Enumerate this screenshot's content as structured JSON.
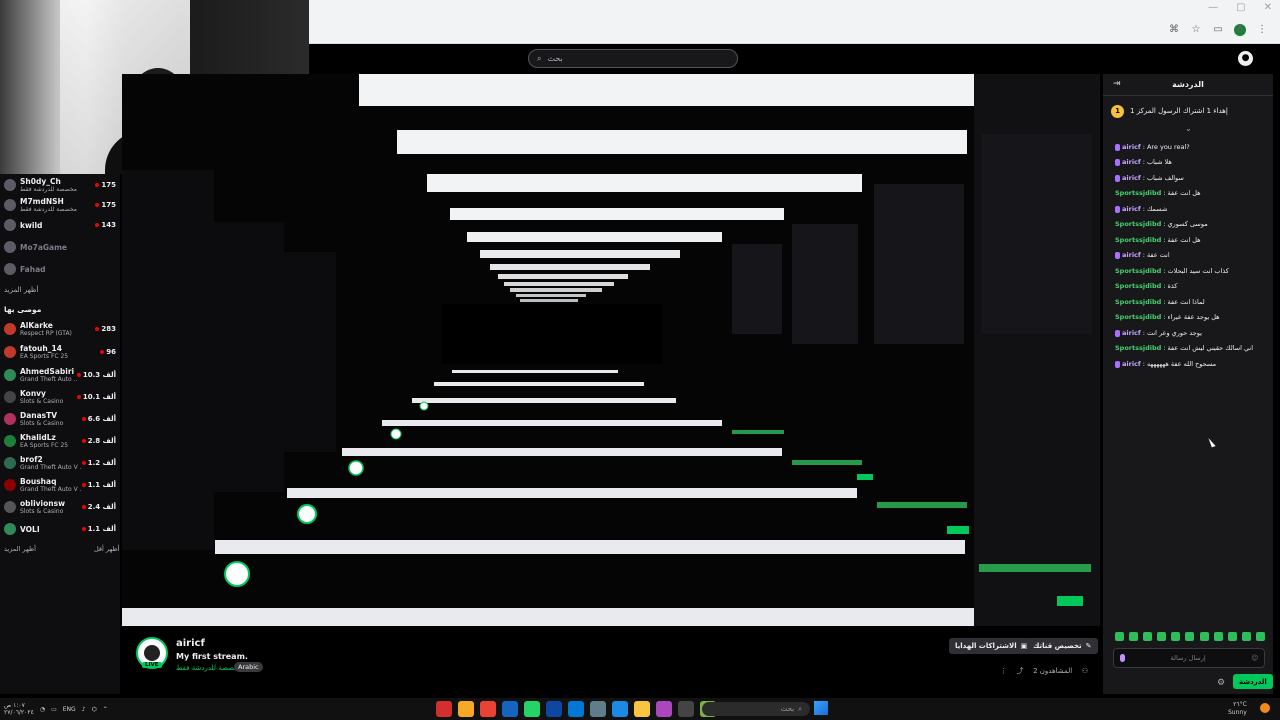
{
  "header": {
    "search_placeholder": "بحث"
  },
  "sidebar": {
    "top_channels": [
      {
        "name": "Sh0dy_Ch",
        "category": "مخصصة للدردشة فقط",
        "viewers": "175",
        "online": true
      },
      {
        "name": "M7mdNSH",
        "category": "مخصصة للدردشة فقط",
        "viewers": "175",
        "online": true
      },
      {
        "name": "kwild",
        "category": "",
        "viewers": "143",
        "online": true
      },
      {
        "name": "Mo7aGame",
        "category": "",
        "viewers": "",
        "online": false
      },
      {
        "name": "Fahad",
        "category": "",
        "viewers": "",
        "online": false
      }
    ],
    "show_more_1": "أظهر المزيد",
    "recommended_heading": "موصى بها",
    "recommended": [
      {
        "name": "AlKarke",
        "category": "Respect RP (GTA)",
        "viewers": "283"
      },
      {
        "name": "fatouh_14",
        "category": "EA Sports FC 25",
        "viewers": "96"
      },
      {
        "name": "AhmedSabiri",
        "category": "Grand Theft Auto ...",
        "viewers": "10.3 ألف"
      },
      {
        "name": "Konvy",
        "category": "Slots & Casino",
        "viewers": "10.1 ألف"
      },
      {
        "name": "DanasTV",
        "category": "Slots & Casino",
        "viewers": "6.6 ألف"
      },
      {
        "name": "KhalidLz",
        "category": "EA Sports FC 25",
        "viewers": "2.8 ألف"
      },
      {
        "name": "brof2",
        "category": "Grand Theft Auto V ...",
        "viewers": "1.2 ألف"
      },
      {
        "name": "Boushaq",
        "category": "Grand Theft Auto V ...",
        "viewers": "1.1 ألف"
      },
      {
        "name": "oblivionsw",
        "category": "Slots & Casino",
        "viewers": "2.4 ألف"
      },
      {
        "name": "VOLI",
        "category": "",
        "viewers": "1.1 ألف"
      }
    ],
    "show_more_2": "أظهر المزيد",
    "show_less": "أظهر أقل"
  },
  "stream": {
    "channel": "airicf",
    "title": "My first stream.",
    "category": "مخصصة للدردشة فقط",
    "language": "Arabic",
    "live": "LIVE",
    "subscriptions_button": "الاشتراكات الهدايا",
    "customize_button": "تخصيص قناتك",
    "viewers_label": "2 المشاهدون"
  },
  "chat": {
    "header": "الدردشة",
    "pinned": "إهداء 1 اشتراك الرسول المركز 1",
    "messages": [
      {
        "user": "airicf",
        "text": "Are you real?",
        "type": "a"
      },
      {
        "user": "airicf",
        "text": "هلا شباب",
        "type": "a"
      },
      {
        "user": "airicf",
        "text": "سوالف شباب",
        "type": "a"
      },
      {
        "user": "Sportssjdibd",
        "text": "هل انت عفة",
        "type": "s"
      },
      {
        "user": "airicf",
        "text": "شسمك",
        "type": "a"
      },
      {
        "user": "Sportssjdibd",
        "text": "موسى كسوري",
        "type": "s"
      },
      {
        "user": "Sportssjdibd",
        "text": "هل انت عفة",
        "type": "s"
      },
      {
        "user": "airicf",
        "text": "انت عفة",
        "type": "a"
      },
      {
        "user": "Sportssjdibd",
        "text": "كذاب انت سيد البحلات",
        "type": "s"
      },
      {
        "user": "Sportssjdibd",
        "text": "كذة",
        "type": "s"
      },
      {
        "user": "Sportssjdibd",
        "text": "لماذا انت عفة",
        "type": "s"
      },
      {
        "user": "Sportssjdibd",
        "text": "هل يوجد عفة عيراء",
        "type": "s"
      },
      {
        "user": "airicf",
        "text": "يوجد حوري وعر انت",
        "type": "a"
      },
      {
        "user": "Sportssjdibd",
        "text": "اني اسالك حقيني ليش انت عفة",
        "type": "s"
      },
      {
        "user": "airicf",
        "text": "مسحوح الله عفة ههههههه",
        "type": "a"
      }
    ],
    "input_placeholder": "إرسال رسالة",
    "send_button": "الدردشة"
  },
  "taskbar": {
    "language": "ENG",
    "time": "١:٠٧ ص",
    "date": "٢٧/٠٦/٢٠٢٤",
    "search": "بحث",
    "weather_temp": "٢٦°C",
    "weather_text": "Sunny"
  },
  "colors": {
    "accent": "#00c85a",
    "chat_user_a": "#c9a6ff",
    "chat_user_s": "#45d16e"
  }
}
